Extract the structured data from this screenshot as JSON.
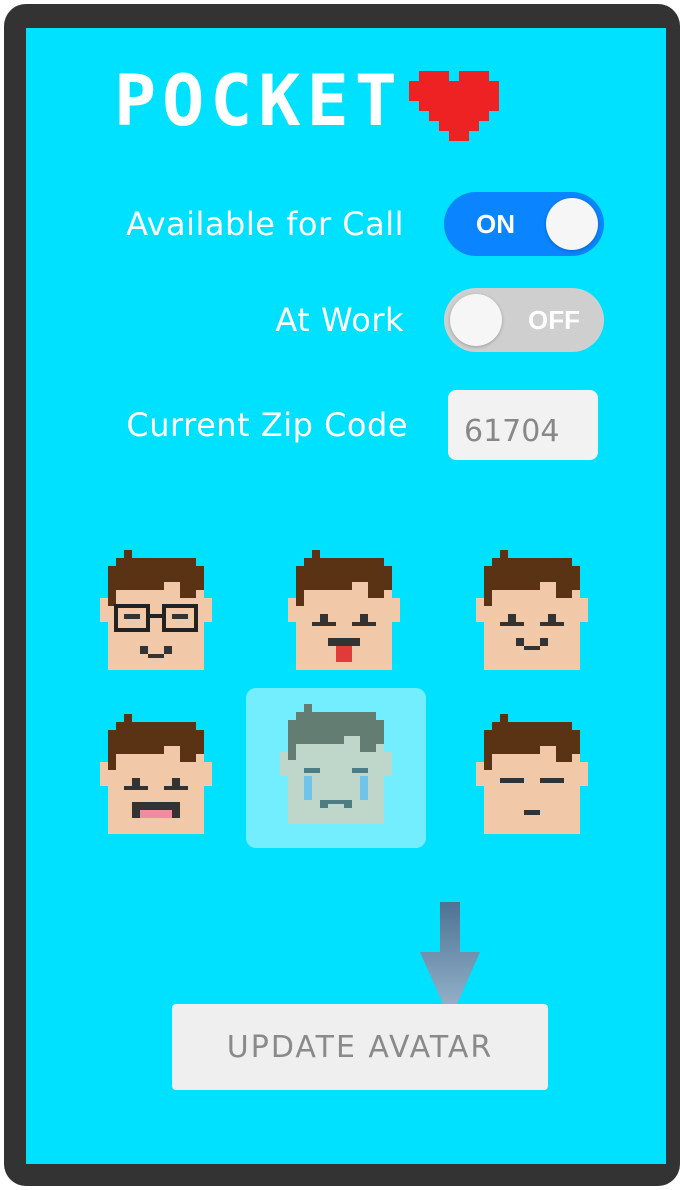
{
  "app": {
    "logo_text": "POCKET",
    "logo_icon": "pixel-heart-icon",
    "heart_color": "#EE2222"
  },
  "settings": {
    "available_for_call": {
      "label": "Available for Call",
      "state": "ON",
      "on": true
    },
    "at_work": {
      "label": "At Work",
      "state": "OFF",
      "on": false
    },
    "zip_code": {
      "label": "Current Zip Code",
      "value": "61704"
    }
  },
  "avatars": [
    {
      "name": "glasses-smile",
      "selected": false
    },
    {
      "name": "tongue-out",
      "selected": false
    },
    {
      "name": "happy-smile",
      "selected": false
    },
    {
      "name": "laughing",
      "selected": false
    },
    {
      "name": "crying",
      "selected": true
    },
    {
      "name": "sleepy",
      "selected": false
    }
  ],
  "update_button": {
    "label": "UPDATE AVATAR"
  },
  "colors": {
    "background": "#00E0FF",
    "toggle_on": "#0A84FF",
    "toggle_off": "#CFCFCF",
    "hair": "#5A3315",
    "skin": "#F2C9A8"
  }
}
